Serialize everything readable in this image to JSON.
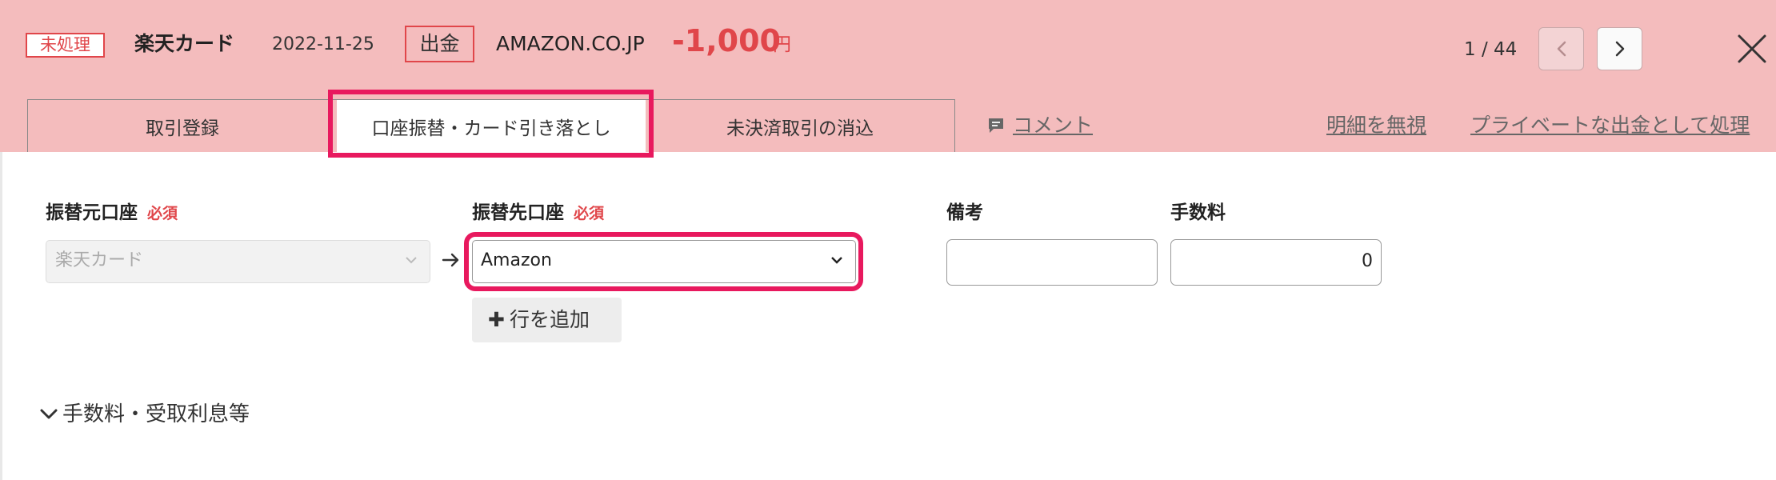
{
  "header": {
    "status_badge": "未処理",
    "account_name": "楽天カード",
    "date": "2022-11-25",
    "type_badge": "出金",
    "merchant": "AMAZON.CO.JP",
    "amount": "-1,000",
    "currency": "円",
    "pager": "1 / 44"
  },
  "tabs": [
    {
      "label": "取引登録"
    },
    {
      "label": "口座振替・カード引き落とし",
      "active": true
    },
    {
      "label": "未決済取引の消込"
    }
  ],
  "links": {
    "comment": "コメント",
    "ignore": "明細を無視",
    "private": "プライベートな出金として処理"
  },
  "form": {
    "from_label": "振替元口座",
    "to_label": "振替先口座",
    "required": "必須",
    "from_value": "楽天カード",
    "to_value": "Amazon",
    "remarks_label": "備考",
    "remarks_value": "",
    "fee_label": "手数料",
    "fee_value": "0",
    "add_row": "行を追加",
    "expand_label": "手数料・受取利息等"
  },
  "colors": {
    "header_bg": "#f4bcbd",
    "accent_red": "#e0464a",
    "highlight": "#e8195e"
  }
}
